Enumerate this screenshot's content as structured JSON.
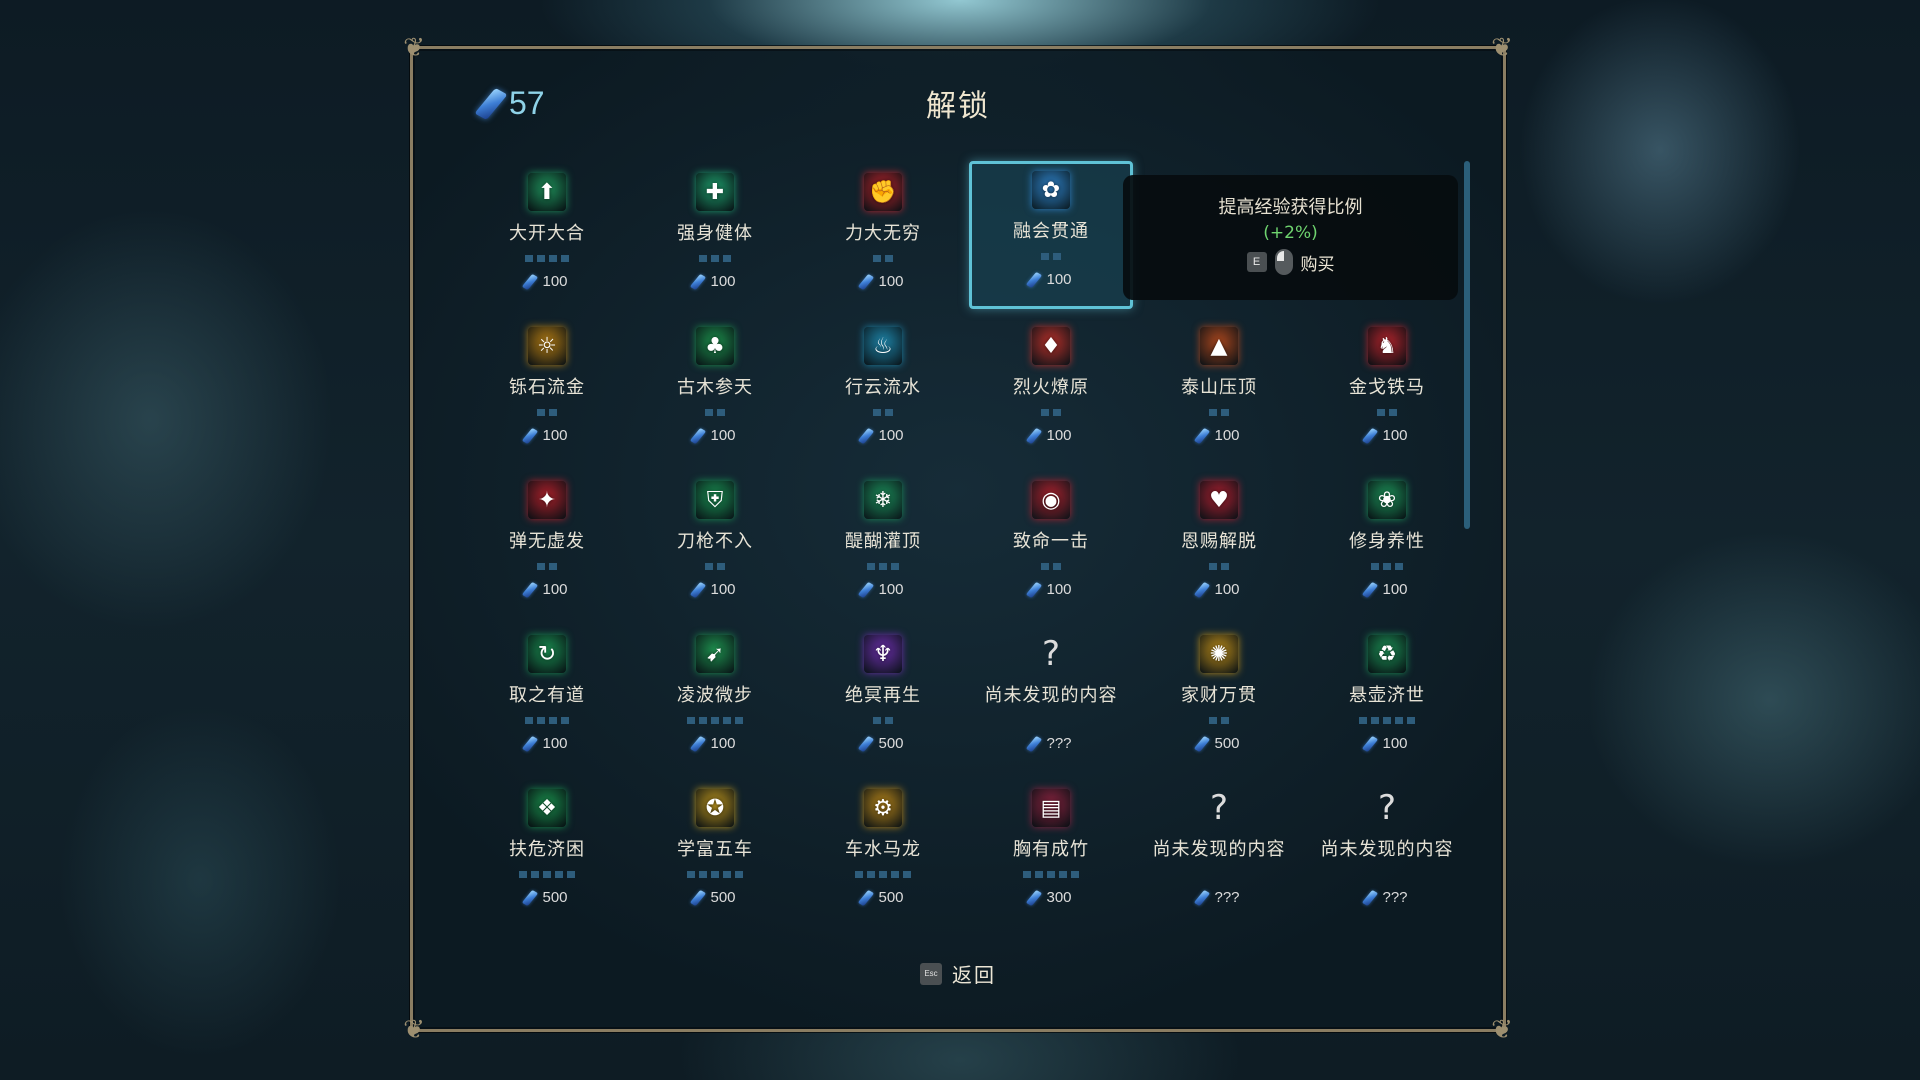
{
  "header": {
    "title": "解锁",
    "currency": "57"
  },
  "tooltip": {
    "description": "提高经验获得比例",
    "bonus": "(+2%)",
    "key": "E",
    "action": "购买"
  },
  "footer": {
    "key": "Esc",
    "back_label": "返回"
  },
  "colors": {
    "accent": "#5fc2d6",
    "pip_filled": "#5aa9e0",
    "pip_empty": "#2e5d7c",
    "bonus": "#6fd46f"
  },
  "items": [
    {
      "name": "大开大合",
      "cost": "100",
      "pips": 4,
      "filled": 0,
      "icon": "up-arrow-icon",
      "icon_color": "#1f8f5a",
      "glyph": "⬆"
    },
    {
      "name": "强身健体",
      "cost": "100",
      "pips": 3,
      "filled": 0,
      "icon": "plus-shield-icon",
      "icon_color": "#1e9a6a",
      "glyph": "✚"
    },
    {
      "name": "力大无穷",
      "cost": "100",
      "pips": 2,
      "filled": 0,
      "icon": "fist-icon",
      "icon_color": "#b8262e",
      "glyph": "✊"
    },
    {
      "name": "融会贯通",
      "cost": "100",
      "pips": 2,
      "filled": 0,
      "icon": "flower-icon",
      "icon_color": "#2e7fc4",
      "glyph": "✿",
      "selected": true
    },
    {
      "name": "",
      "cost": "",
      "pips": 0,
      "filled": 0,
      "hidden": true
    },
    {
      "name": "",
      "cost": "",
      "pips": 0,
      "filled": 0,
      "hidden": true
    },
    {
      "name": "铄石流金",
      "cost": "100",
      "pips": 2,
      "filled": 0,
      "icon": "sun-gear-icon",
      "icon_color": "#b07a14",
      "glyph": "☼"
    },
    {
      "name": "古木参天",
      "cost": "100",
      "pips": 2,
      "filled": 0,
      "icon": "tree-icon",
      "icon_color": "#1d8f4c",
      "glyph": "♣"
    },
    {
      "name": "行云流水",
      "cost": "100",
      "pips": 2,
      "filled": 0,
      "icon": "water-drop-icon",
      "icon_color": "#1e84a8",
      "glyph": "♨"
    },
    {
      "name": "烈火燎原",
      "cost": "100",
      "pips": 2,
      "filled": 0,
      "icon": "fire-icon",
      "icon_color": "#b5302a",
      "glyph": "♦"
    },
    {
      "name": "泰山压顶",
      "cost": "100",
      "pips": 2,
      "filled": 0,
      "icon": "mountain-icon",
      "icon_color": "#a8461e",
      "glyph": "▲"
    },
    {
      "name": "金戈铁马",
      "cost": "100",
      "pips": 2,
      "filled": 0,
      "icon": "horse-icon",
      "icon_color": "#b0242c",
      "glyph": "♞"
    },
    {
      "name": "弹无虚发",
      "cost": "100",
      "pips": 2,
      "filled": 0,
      "icon": "winged-target-icon",
      "icon_color": "#a8202a",
      "glyph": "✦"
    },
    {
      "name": "刀枪不入",
      "cost": "100",
      "pips": 2,
      "filled": 0,
      "icon": "shield-icon",
      "icon_color": "#1a8f52",
      "glyph": "⛨"
    },
    {
      "name": "醍醐灌顶",
      "cost": "100",
      "pips": 3,
      "filled": 0,
      "icon": "snowflake-icon",
      "icon_color": "#1b8a58",
      "glyph": "❄"
    },
    {
      "name": "致命一击",
      "cost": "100",
      "pips": 2,
      "filled": 0,
      "icon": "eye-icon",
      "icon_color": "#a8222e",
      "glyph": "◉"
    },
    {
      "name": "恩赐解脱",
      "cost": "100",
      "pips": 2,
      "filled": 0,
      "icon": "heart-flame-icon",
      "icon_color": "#a82030",
      "glyph": "♥"
    },
    {
      "name": "修身养性",
      "cost": "100",
      "pips": 3,
      "filled": 0,
      "icon": "lotus-icon",
      "icon_color": "#1d9058",
      "glyph": "❀"
    },
    {
      "name": "取之有道",
      "cost": "100",
      "pips": 4,
      "filled": 0,
      "icon": "cycle-arrow-icon",
      "icon_color": "#1a8c50",
      "glyph": "↻"
    },
    {
      "name": "凌波微步",
      "cost": "100",
      "pips": 5,
      "filled": 0,
      "icon": "boot-icon",
      "icon_color": "#1e8f4e",
      "glyph": "➹"
    },
    {
      "name": "绝冥再生",
      "cost": "500",
      "pips": 2,
      "filled": 0,
      "icon": "demon-mask-icon",
      "icon_color": "#6a2fa8",
      "glyph": "♆"
    },
    {
      "name": "尚未发现的内容",
      "cost": "???",
      "unknown": true
    },
    {
      "name": "家财万贯",
      "cost": "500",
      "pips": 2,
      "filled": 0,
      "icon": "gold-coins-icon",
      "icon_color": "#b88a1a",
      "glyph": "✺"
    },
    {
      "name": "悬壶济世",
      "cost": "100",
      "pips": 5,
      "filled": 0,
      "icon": "gourd-icon",
      "icon_color": "#1c8e54",
      "glyph": "♻"
    },
    {
      "name": "扶危济困",
      "cost": "500",
      "pips": 5,
      "filled": 0,
      "icon": "hands-icon",
      "icon_color": "#1a8c4c",
      "glyph": "❖"
    },
    {
      "name": "学富五车",
      "cost": "500",
      "pips": 5,
      "filled": 0,
      "icon": "scroll-gold-icon",
      "icon_color": "#b8921e",
      "glyph": "✪"
    },
    {
      "name": "车水马龙",
      "cost": "500",
      "pips": 5,
      "filled": 0,
      "icon": "cart-gold-icon",
      "icon_color": "#b5841a",
      "glyph": "⚙"
    },
    {
      "name": "胸有成竹",
      "cost": "300",
      "pips": 5,
      "filled": 0,
      "icon": "book-icon",
      "icon_color": "#8a2440",
      "glyph": "▤"
    },
    {
      "name": "尚未发现的内容",
      "cost": "???",
      "unknown": true
    },
    {
      "name": "尚未发现的内容",
      "cost": "???",
      "unknown": true
    }
  ]
}
